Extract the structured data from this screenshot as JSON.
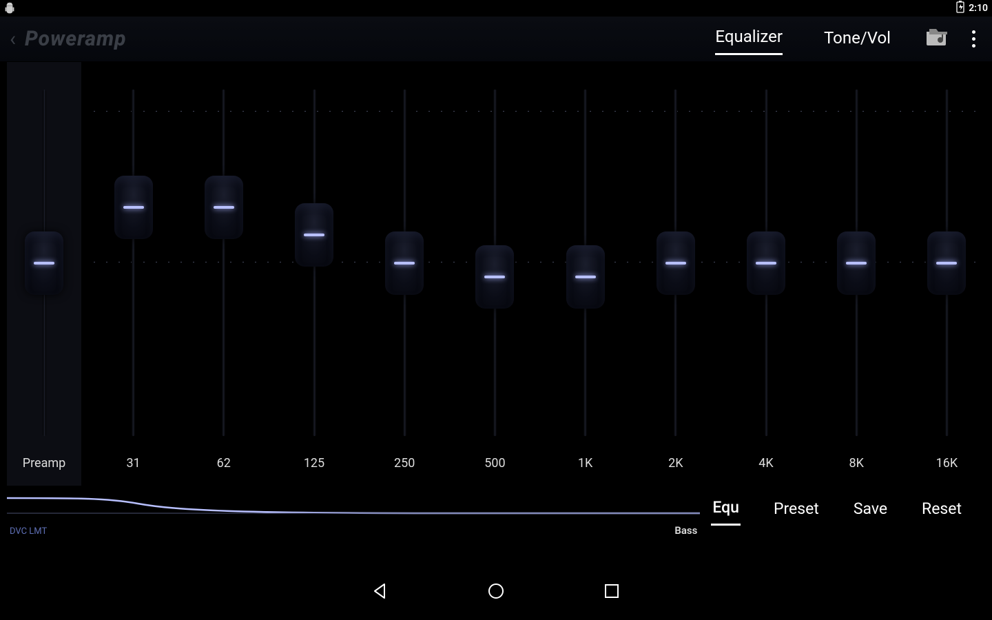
{
  "status": {
    "time": "2:10"
  },
  "header": {
    "app_name": "Poweramp",
    "tabs": [
      {
        "label": "Equalizer",
        "active": true
      },
      {
        "label": "Tone/Vol",
        "active": false
      }
    ]
  },
  "eq": {
    "preamp": {
      "label": "Preamp",
      "value": 0.5
    },
    "bands": [
      {
        "label": "31",
        "value": 0.66
      },
      {
        "label": "62",
        "value": 0.66
      },
      {
        "label": "125",
        "value": 0.58
      },
      {
        "label": "250",
        "value": 0.5
      },
      {
        "label": "500",
        "value": 0.46
      },
      {
        "label": "1K",
        "value": 0.46
      },
      {
        "label": "2K",
        "value": 0.5
      },
      {
        "label": "4K",
        "value": 0.5
      },
      {
        "label": "8K",
        "value": 0.5
      },
      {
        "label": "16K",
        "value": 0.5
      }
    ]
  },
  "response": {
    "dvc_label": "DVC LMT",
    "bass_label": "Bass"
  },
  "bottom": {
    "buttons": [
      {
        "label": "Equ",
        "active": true
      },
      {
        "label": "Preset",
        "active": false
      },
      {
        "label": "Save",
        "active": false
      },
      {
        "label": "Reset",
        "active": false
      }
    ]
  }
}
